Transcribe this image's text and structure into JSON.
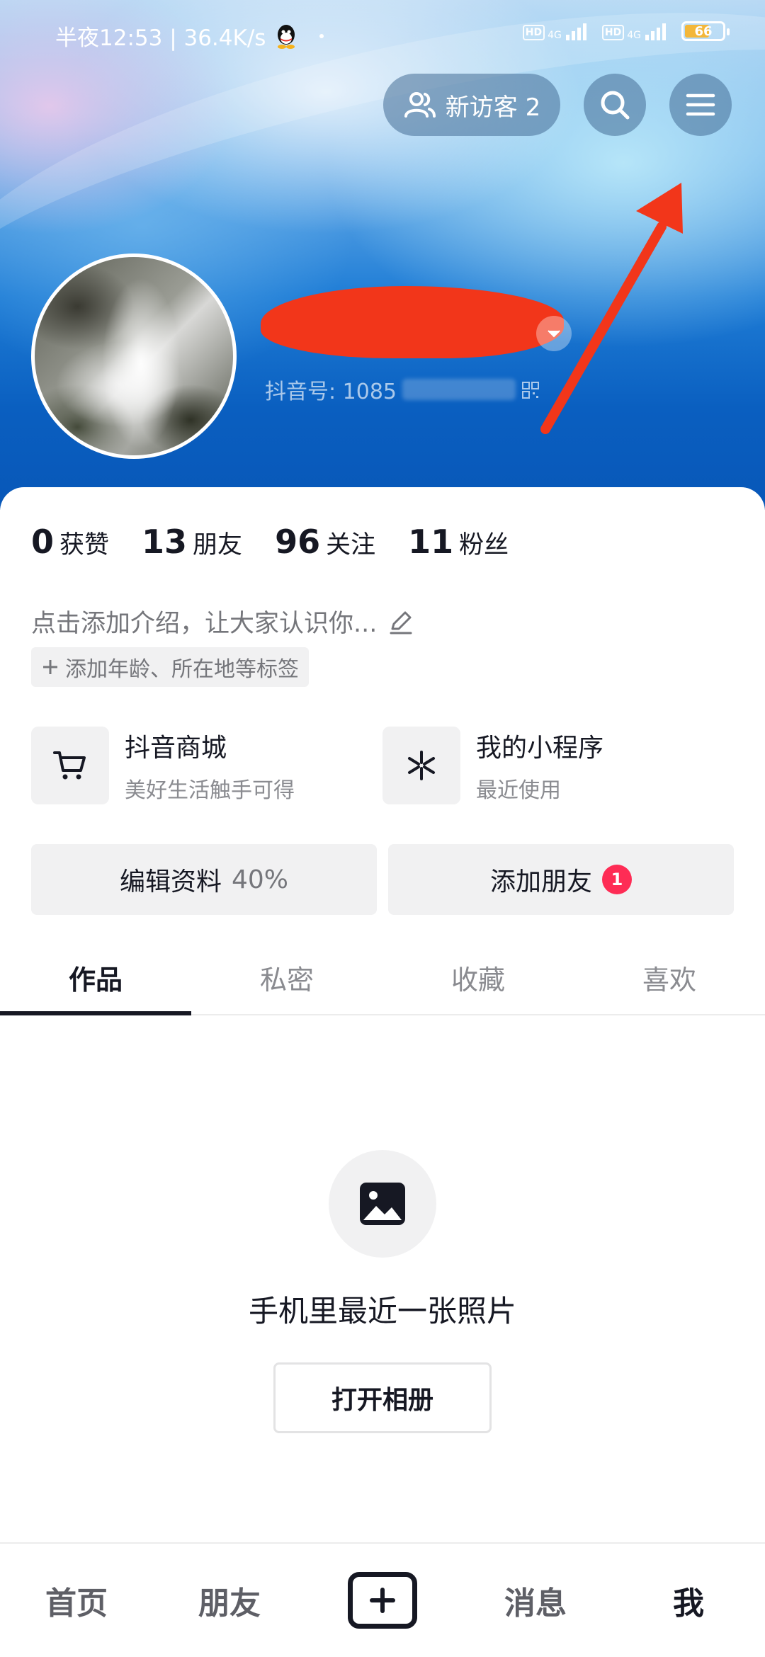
{
  "status_bar": {
    "time_speed": "半夜12:53 | 36.4K/s",
    "sim1_hd": "HD",
    "sim1_net": "4G",
    "sim2_hd": "HD",
    "sim2_net": "4G",
    "battery_level": "66",
    "icons": [
      "qq-icon",
      "signal-icon",
      "battery-icon"
    ]
  },
  "header": {
    "visitors_label": "新访客 2",
    "visitor_icon": "users-icon",
    "search_icon": "search-icon",
    "menu_icon": "menu-icon"
  },
  "profile": {
    "douyin_id_prefix": "抖音号: 1085",
    "qr_icon": "qr-code-icon"
  },
  "stats": [
    {
      "num": "0",
      "label": "获赞"
    },
    {
      "num": "13",
      "label": "朋友"
    },
    {
      "num": "96",
      "label": "关注"
    },
    {
      "num": "11",
      "label": "粉丝"
    }
  ],
  "bio": {
    "placeholder": "点击添加介绍，让大家认识你...",
    "tag_chip": "添加年龄、所在地等标签"
  },
  "services": {
    "mall": {
      "title": "抖音商城",
      "subtitle": "美好生活触手可得",
      "icon": "cart-icon"
    },
    "mini": {
      "title": "我的小程序",
      "subtitle": "最近使用",
      "icon": "mini-program-icon"
    }
  },
  "actions": {
    "edit_profile": "编辑资料",
    "edit_progress": "40%",
    "add_friend": "添加朋友",
    "add_friend_badge": "1"
  },
  "tabs": [
    {
      "label": "作品",
      "active": true
    },
    {
      "label": "私密",
      "active": false
    },
    {
      "label": "收藏",
      "active": false
    },
    {
      "label": "喜欢",
      "active": false
    }
  ],
  "empty_state": {
    "title": "手机里最近一张照片",
    "button": "打开相册",
    "icon": "image-icon"
  },
  "bottom_nav": {
    "home": "首页",
    "friends": "朋友",
    "messages": "消息",
    "me": "我",
    "create_icon": "plus-icon",
    "active": "我"
  },
  "colors": {
    "accent_red": "#fe2c55",
    "annotation_red": "#f2361a",
    "text_primary": "#161823",
    "text_secondary": "#75767b"
  }
}
